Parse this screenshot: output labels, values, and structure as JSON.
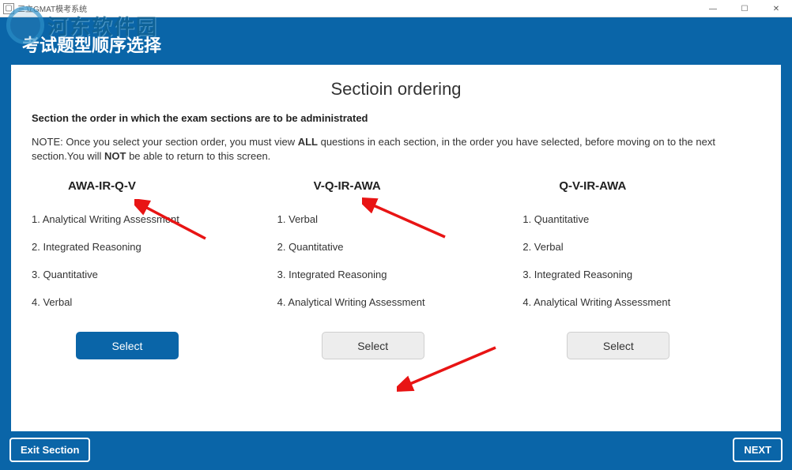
{
  "titlebar": {
    "title": "三立GMAT模考系统"
  },
  "watermark": {
    "text": "河东软件园"
  },
  "app": {
    "header": "考试题型顺序选择"
  },
  "card": {
    "title": "Sectioin ordering",
    "bold_line": "Section the order in which the exam sections are to be administrated",
    "note": {
      "p1": "NOTE: Once you select your section order, you must view ",
      "b1": "ALL",
      "p2": " questions in each section, in the order you have selected, before moving on to the next section.You will ",
      "b2": "NOT",
      "p3": " be able to return to this screen."
    }
  },
  "columns": [
    {
      "title": "AWA-IR-Q-V",
      "items": [
        "1. Analytical Writing Assessment",
        "2. Integrated Reasoning",
        "3. Quantitative",
        "4. Verbal"
      ],
      "button": "Select",
      "active": true
    },
    {
      "title": "V-Q-IR-AWA",
      "items": [
        "1. Verbal",
        "2. Quantitative",
        "3. Integrated Reasoning",
        "4. Analytical Writing Assessment"
      ],
      "button": "Select",
      "active": false
    },
    {
      "title": "Q-V-IR-AWA",
      "items": [
        "1. Quantitative",
        "2. Verbal",
        "3. Integrated Reasoning",
        "4. Analytical Writing Assessment"
      ],
      "button": "Select",
      "active": false
    }
  ],
  "footer": {
    "exit": "Exit Section",
    "next": "NEXT"
  }
}
